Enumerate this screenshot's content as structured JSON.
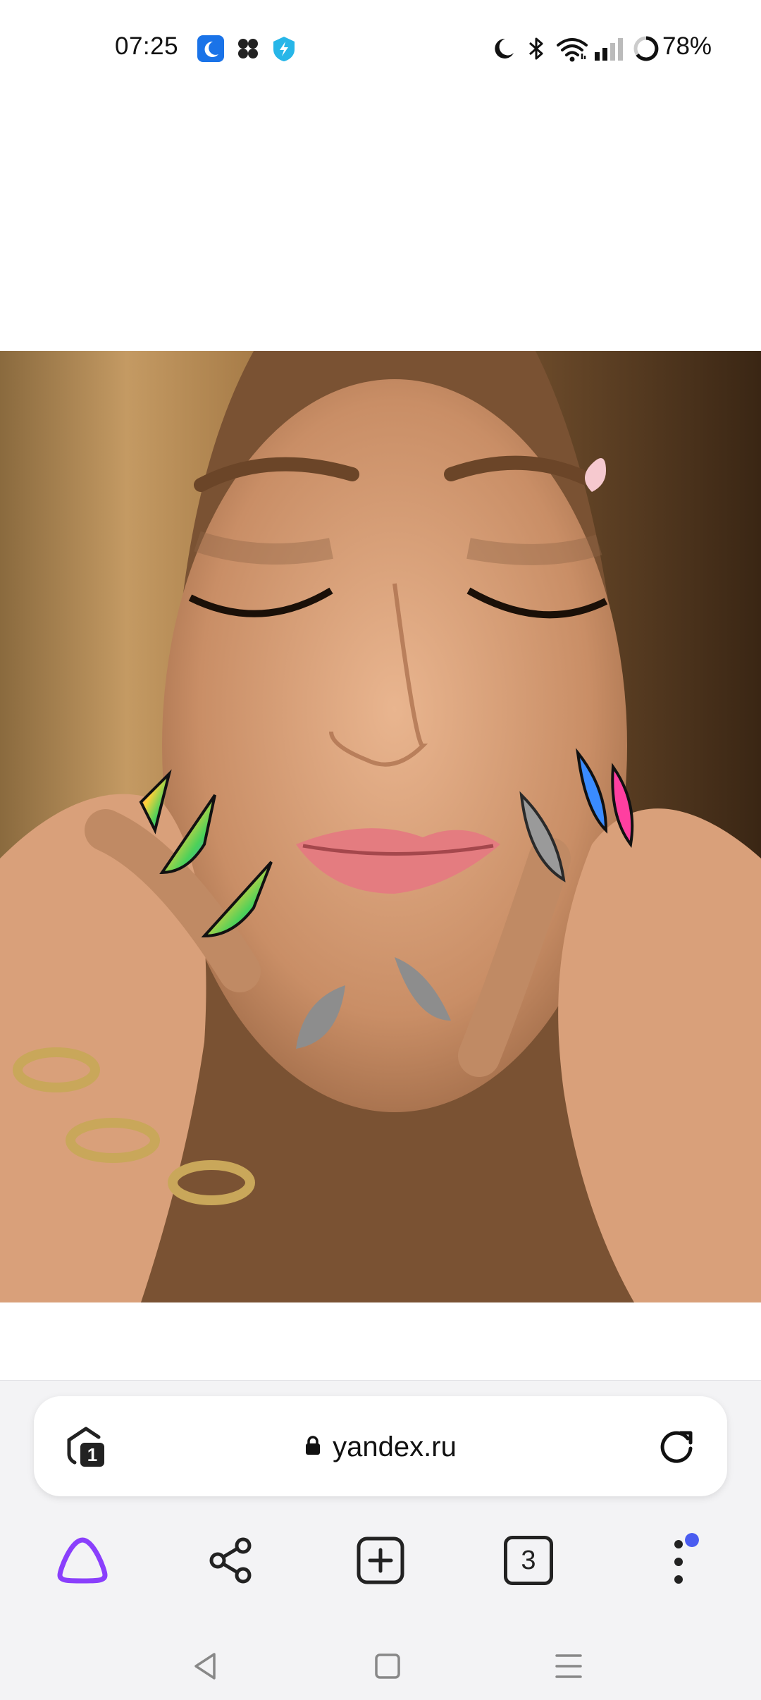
{
  "status_bar": {
    "time": "07:25",
    "battery_percent": "78%",
    "icons": [
      "moon-app-icon",
      "grid-app-icon",
      "shield-bolt-icon",
      "do-not-disturb-icon",
      "bluetooth-icon",
      "wifi-icon",
      "cellular-signal-icon",
      "battery-icon"
    ]
  },
  "browser": {
    "url": "yandex.ru",
    "secure": true,
    "tabs_count": "3",
    "protect_badge_count": "1",
    "menu_has_notification": true
  },
  "content": {
    "image": "photo-close-up-face-with-decorated-nails"
  },
  "colors": {
    "accent_purple": "#8a3ffc",
    "notification_dot": "#4a5cf0"
  },
  "system_nav": [
    "back",
    "home",
    "recents"
  ]
}
